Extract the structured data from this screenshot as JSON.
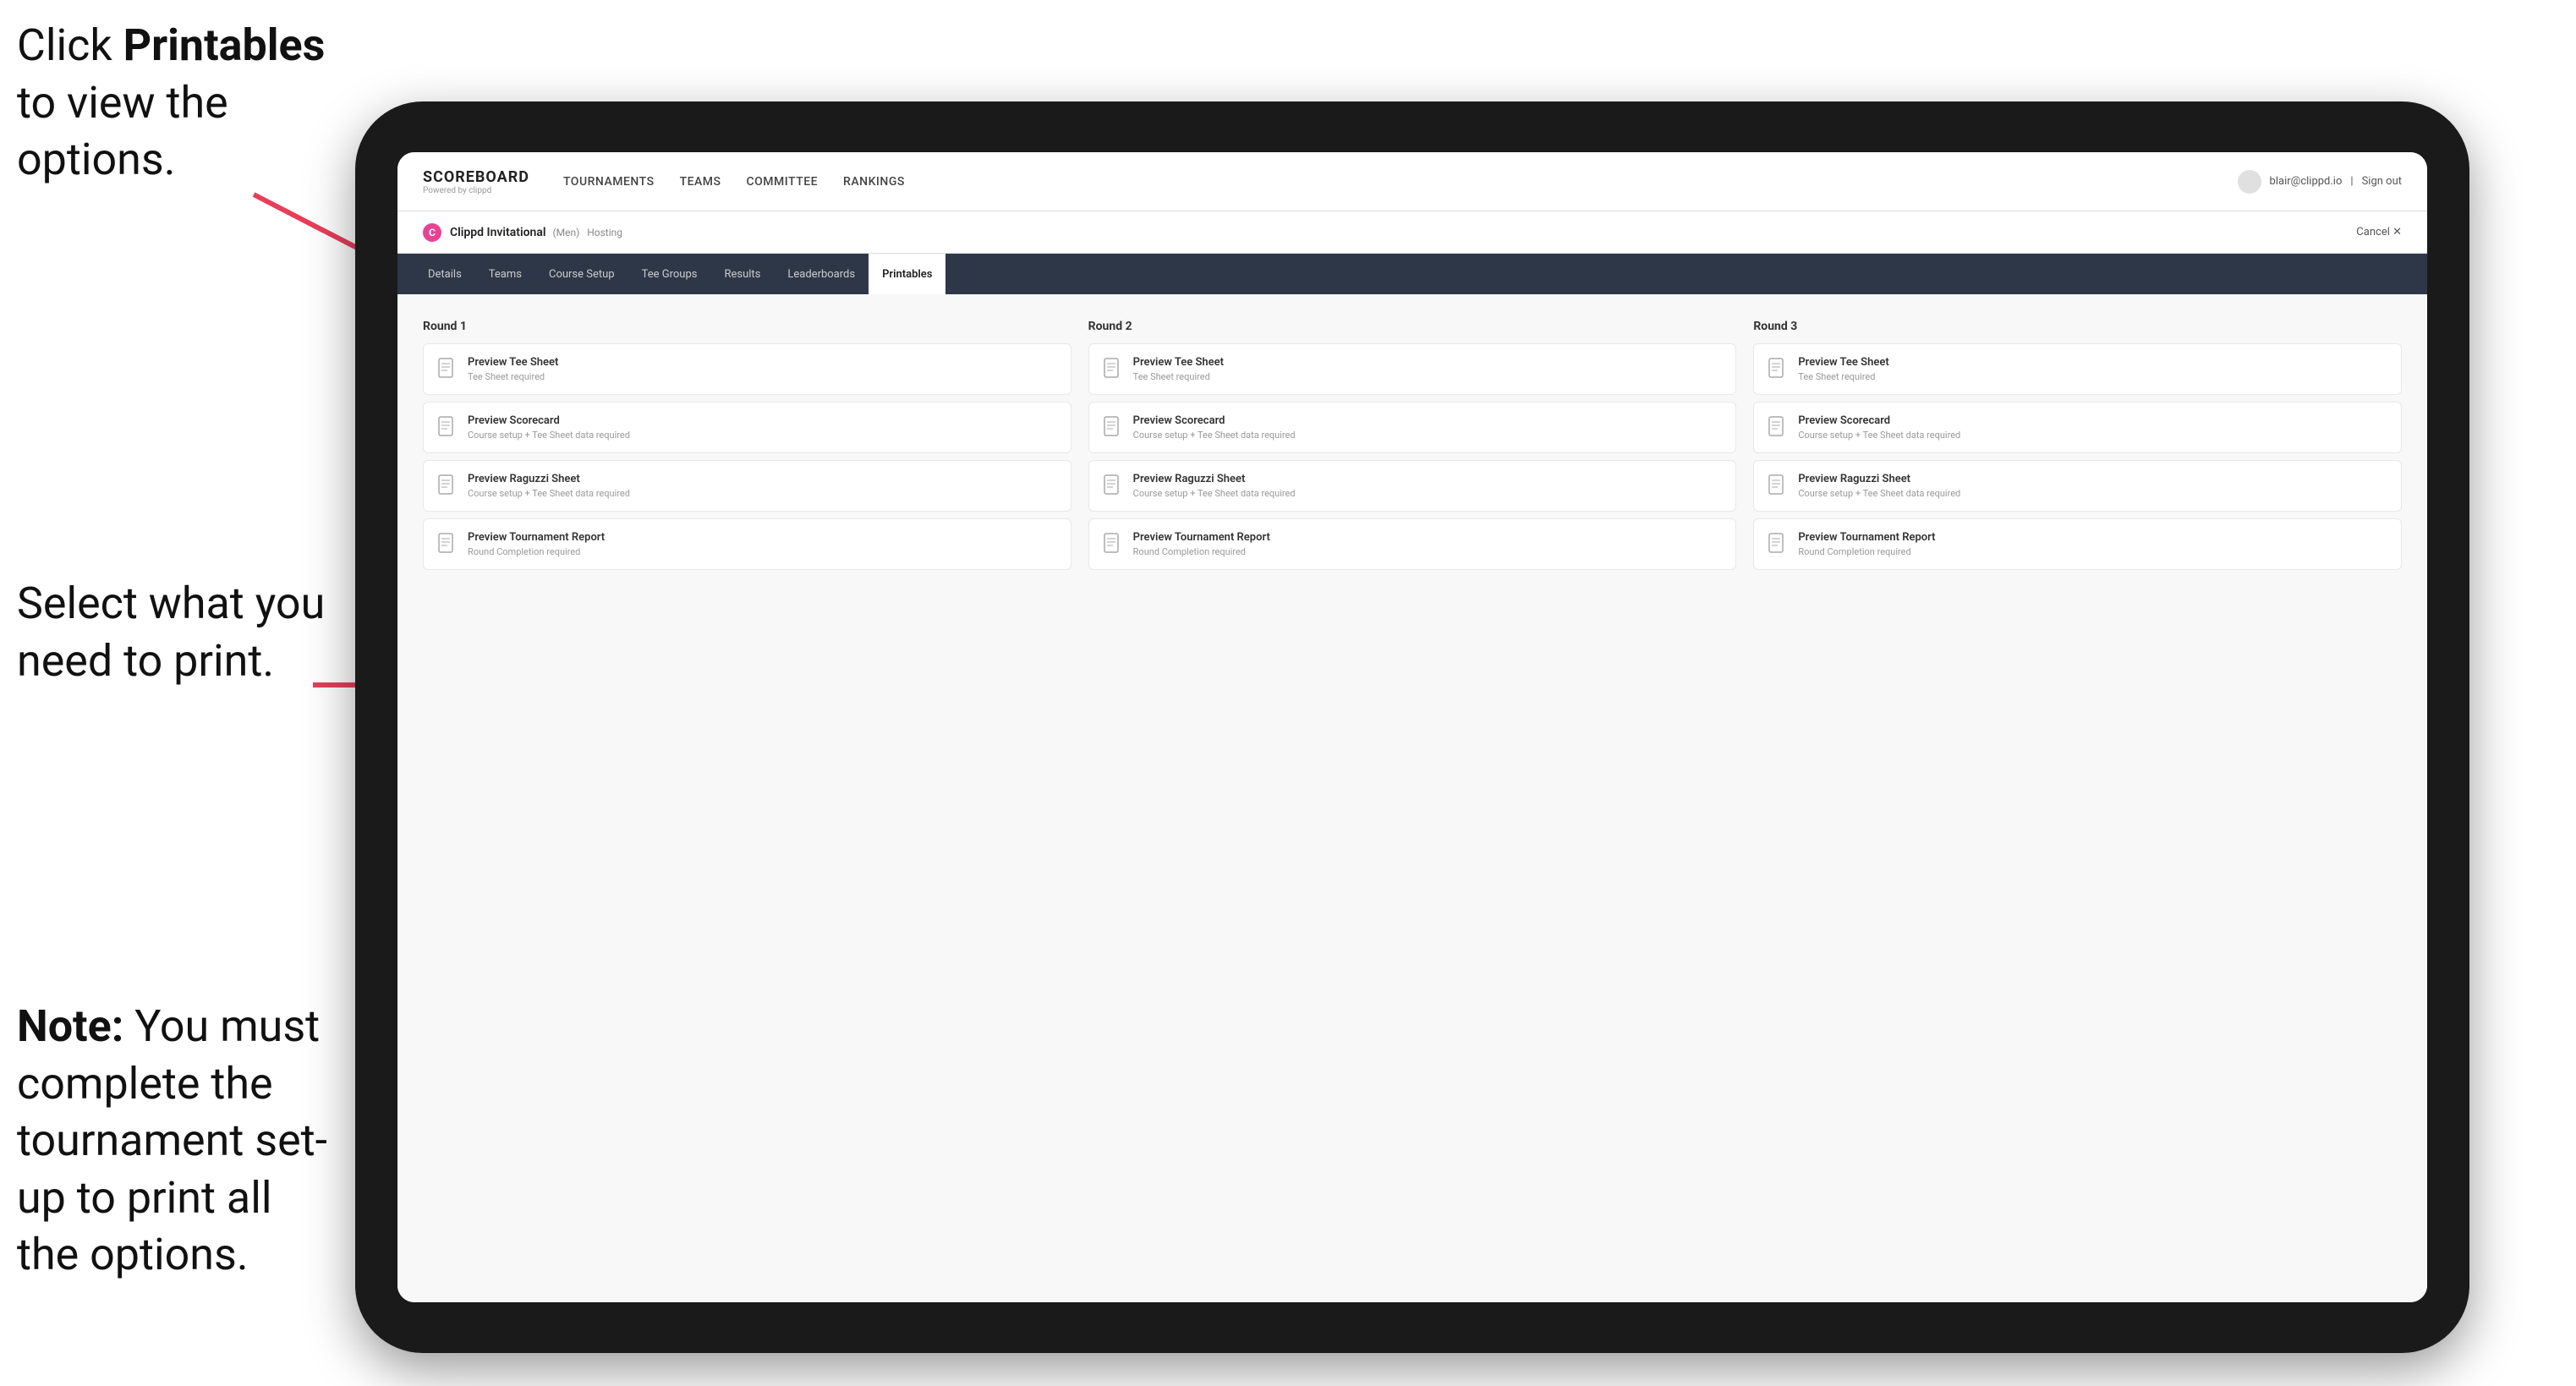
{
  "instructions": {
    "top": "Click ",
    "top_bold": "Printables",
    "top_rest": " to view the options.",
    "mid": "Select what you need to print.",
    "bottom_bold": "Note:",
    "bottom_rest": " You must complete the tournament set-up to print all the options."
  },
  "header": {
    "logo_title": "SCOREBOARD",
    "logo_sub": "Powered by clippd",
    "nav_items": [
      {
        "label": "TOURNAMENTS",
        "active": false
      },
      {
        "label": "TEAMS",
        "active": false
      },
      {
        "label": "COMMITTEE",
        "active": false
      },
      {
        "label": "RANKINGS",
        "active": false
      }
    ],
    "user_email": "blair@clippd.io",
    "sign_out": "Sign out"
  },
  "tournament": {
    "logo_letter": "C",
    "name": "Clippd Invitational",
    "meta": "(Men)",
    "status": "Hosting",
    "cancel": "Cancel ✕"
  },
  "tabs": [
    {
      "label": "Details",
      "active": false
    },
    {
      "label": "Teams",
      "active": false
    },
    {
      "label": "Course Setup",
      "active": false
    },
    {
      "label": "Tee Groups",
      "active": false
    },
    {
      "label": "Results",
      "active": false
    },
    {
      "label": "Leaderboards",
      "active": false
    },
    {
      "label": "Printables",
      "active": true
    }
  ],
  "rounds": [
    {
      "label": "Round 1",
      "cards": [
        {
          "title": "Preview Tee Sheet",
          "subtitle": "Tee Sheet required"
        },
        {
          "title": "Preview Scorecard",
          "subtitle": "Course setup + Tee Sheet data required"
        },
        {
          "title": "Preview Raguzzi Sheet",
          "subtitle": "Course setup + Tee Sheet data required"
        },
        {
          "title": "Preview Tournament Report",
          "subtitle": "Round Completion required"
        }
      ]
    },
    {
      "label": "Round 2",
      "cards": [
        {
          "title": "Preview Tee Sheet",
          "subtitle": "Tee Sheet required"
        },
        {
          "title": "Preview Scorecard",
          "subtitle": "Course setup + Tee Sheet data required"
        },
        {
          "title": "Preview Raguzzi Sheet",
          "subtitle": "Course setup + Tee Sheet data required"
        },
        {
          "title": "Preview Tournament Report",
          "subtitle": "Round Completion required"
        }
      ]
    },
    {
      "label": "Round 3",
      "cards": [
        {
          "title": "Preview Tee Sheet",
          "subtitle": "Tee Sheet required"
        },
        {
          "title": "Preview Scorecard",
          "subtitle": "Course setup + Tee Sheet data required"
        },
        {
          "title": "Preview Raguzzi Sheet",
          "subtitle": "Course setup + Tee Sheet data required"
        },
        {
          "title": "Preview Tournament Report",
          "subtitle": "Round Completion required"
        }
      ]
    }
  ]
}
